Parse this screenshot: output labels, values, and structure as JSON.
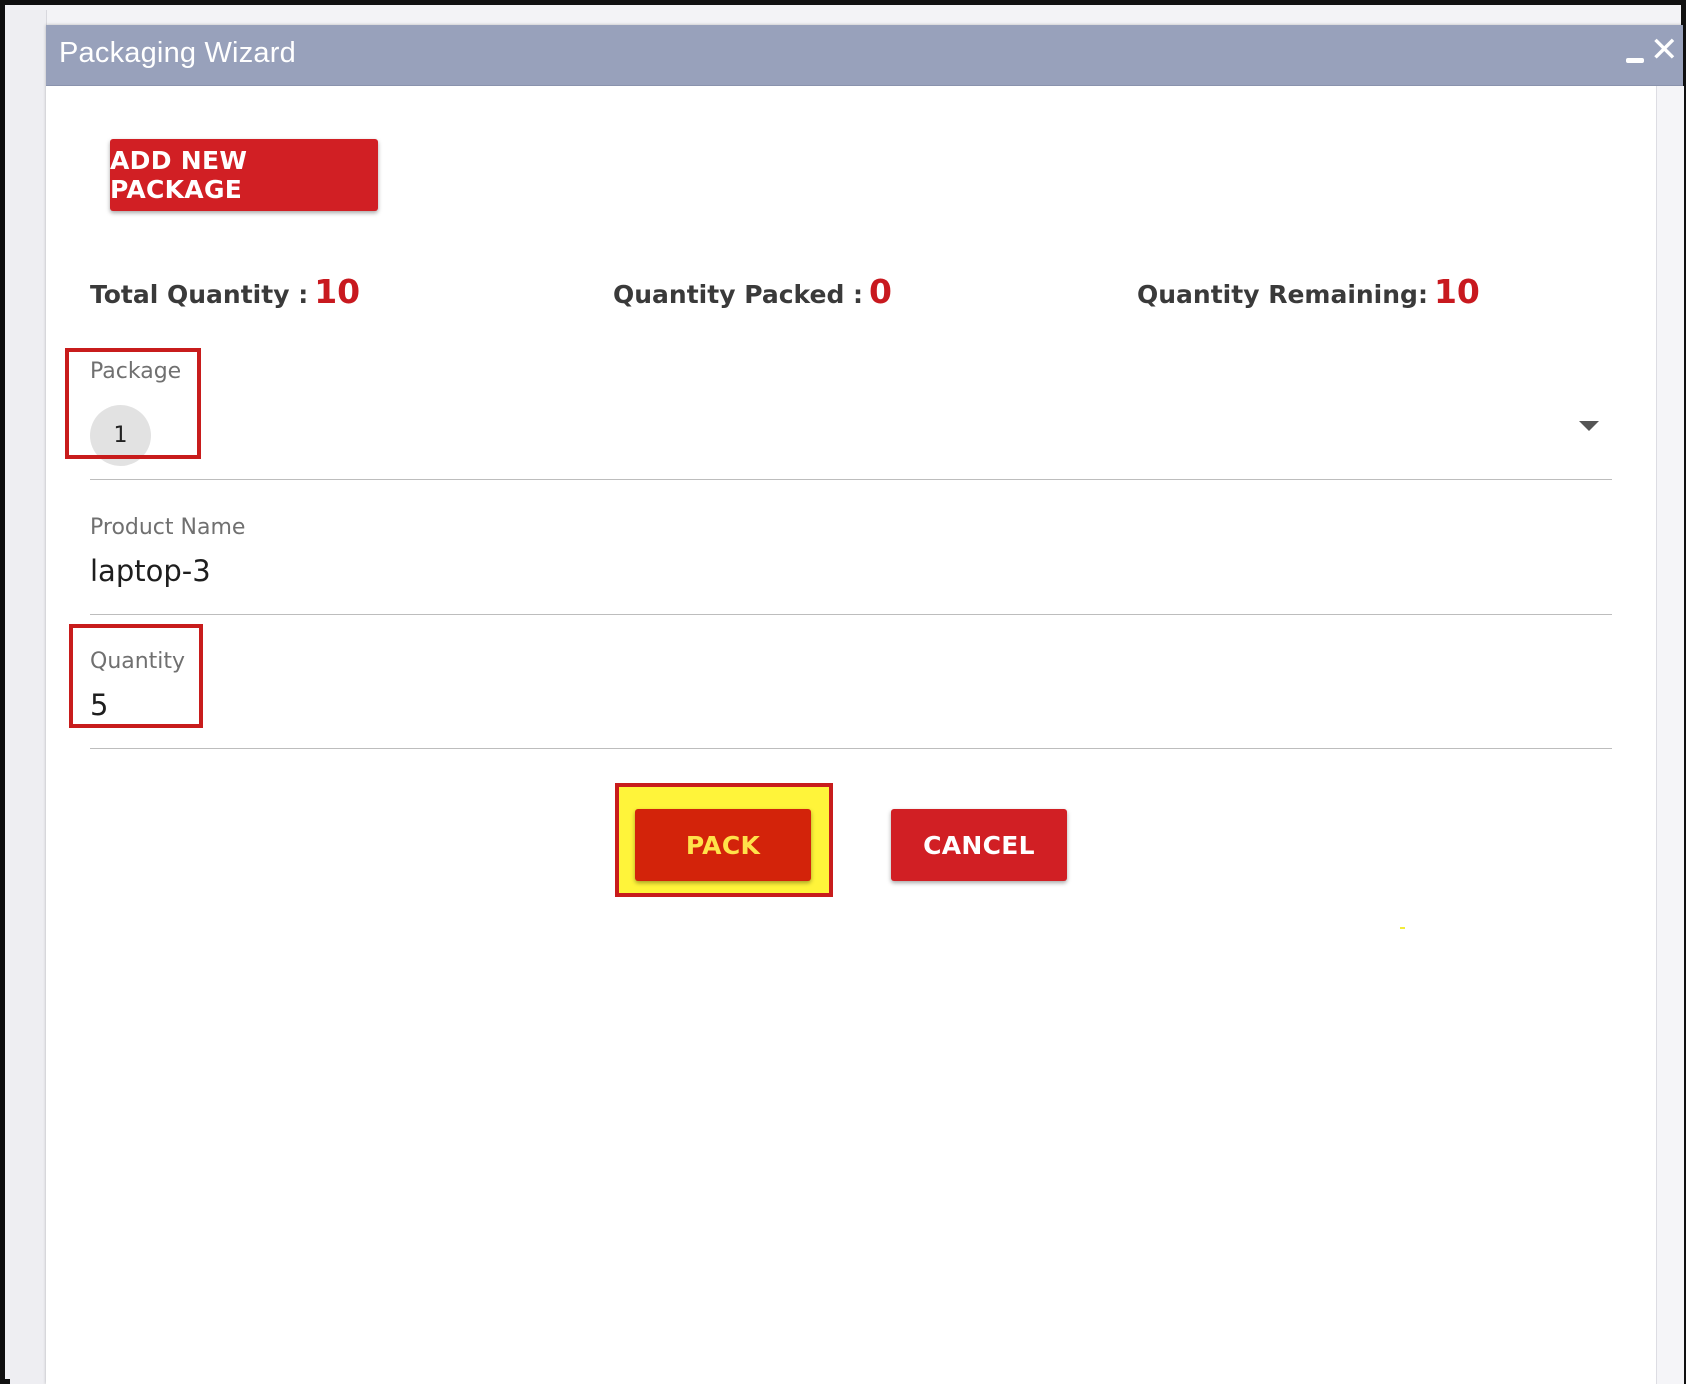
{
  "window": {
    "title": "Packaging Wizard",
    "controls": {
      "minimize_icon": "minimize-icon",
      "close_icon": "close-icon",
      "close_glyph": "✕"
    }
  },
  "actions": {
    "add_package_label": "ADD NEW PACKAGE",
    "pack_label": "PACK",
    "cancel_label": "CANCEL"
  },
  "stats": {
    "total_label": "Total Quantity :",
    "total_value": "10",
    "packed_label": "Quantity Packed :",
    "packed_value": "0",
    "remaining_label": "Quantity Remaining:",
    "remaining_value": "10"
  },
  "form": {
    "package": {
      "label": "Package",
      "selected_chip": "1"
    },
    "product_name": {
      "label": "Product Name",
      "value": "laptop-3"
    },
    "quantity": {
      "label": "Quantity",
      "value": "5"
    }
  },
  "colors": {
    "titlebar": "#98a1bb",
    "primary_button": "#d11f24",
    "accent_value": "#c8191f",
    "highlight": "#fff43a",
    "annotation_border": "#c81c1c"
  }
}
